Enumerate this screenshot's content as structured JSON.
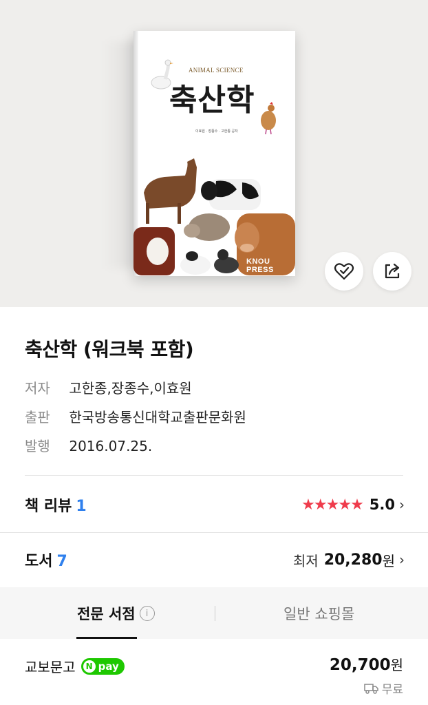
{
  "cover": {
    "subtitle": "ANIMAL SCIENCE",
    "title": "축산학",
    "authors_line": "이효원 · 장종수 · 고한종 공저",
    "publisher_logo": "KNOU PRESS"
  },
  "actions": {
    "like_icon": "heart-check-icon",
    "share_icon": "share-icon"
  },
  "book": {
    "title": "축산학 (워크북 포함)",
    "author_label": "저자",
    "author_value": "고한종,장종수,이효원",
    "publisher_label": "출판",
    "publisher_value": "한국방송통신대학교출판문화원",
    "date_label": "발행",
    "date_value": "2016.07.25."
  },
  "review": {
    "label": "책 리뷰",
    "count": "1",
    "stars": "★★★★★",
    "rating": "5.0",
    "chevron": "›"
  },
  "books": {
    "label": "도서",
    "count": "7",
    "lowest_label": "최저",
    "lowest_price": "20,280",
    "currency": "원",
    "chevron": "›"
  },
  "tabs": {
    "specialist": "전문 서점",
    "info_glyph": "i",
    "general": "일반 쇼핑몰"
  },
  "store": {
    "name": "교보문고",
    "npay_n": "N",
    "npay_text": "pay",
    "price": "20,700",
    "currency": "원",
    "shipping": "무료"
  },
  "colors": {
    "accent_blue": "#2f80ed",
    "star_red": "#ef3b4b",
    "npay_green": "#1ec800"
  }
}
